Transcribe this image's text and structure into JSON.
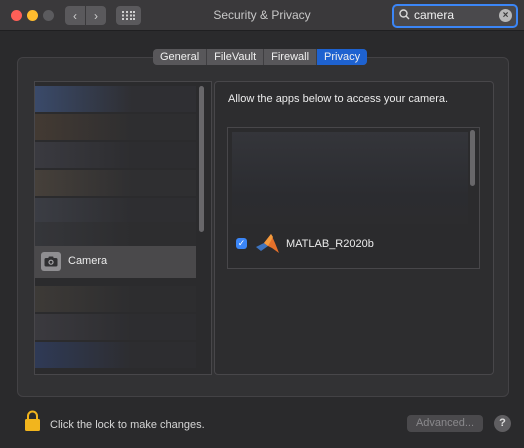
{
  "window": {
    "title": "Security & Privacy",
    "back_glyph": "‹",
    "forward_glyph": "›",
    "grid_icon": "grid-icon"
  },
  "search": {
    "value": "camera",
    "clear_glyph": "×"
  },
  "tabs": [
    {
      "label": "General",
      "active": false
    },
    {
      "label": "FileVault",
      "active": false
    },
    {
      "label": "Firewall",
      "active": false
    },
    {
      "label": "Privacy",
      "active": true
    }
  ],
  "sidebar": {
    "selected_item": {
      "label": "Camera",
      "icon": "camera-icon"
    }
  },
  "main": {
    "description": "Allow the apps below to access your camera.",
    "apps": [
      {
        "name": "MATLAB_R2020b",
        "checked": true,
        "check_glyph": "✓",
        "icon": "matlab-icon"
      }
    ]
  },
  "footer": {
    "lock_text": "Click the lock to make changes.",
    "advanced_label": "Advanced...",
    "help_label": "?"
  },
  "colors": {
    "accent": "#3b86f7",
    "active_tab": "#1e62d0",
    "close": "#fe5f57",
    "minimize": "#febc2e",
    "lock": "#f2b51d"
  }
}
